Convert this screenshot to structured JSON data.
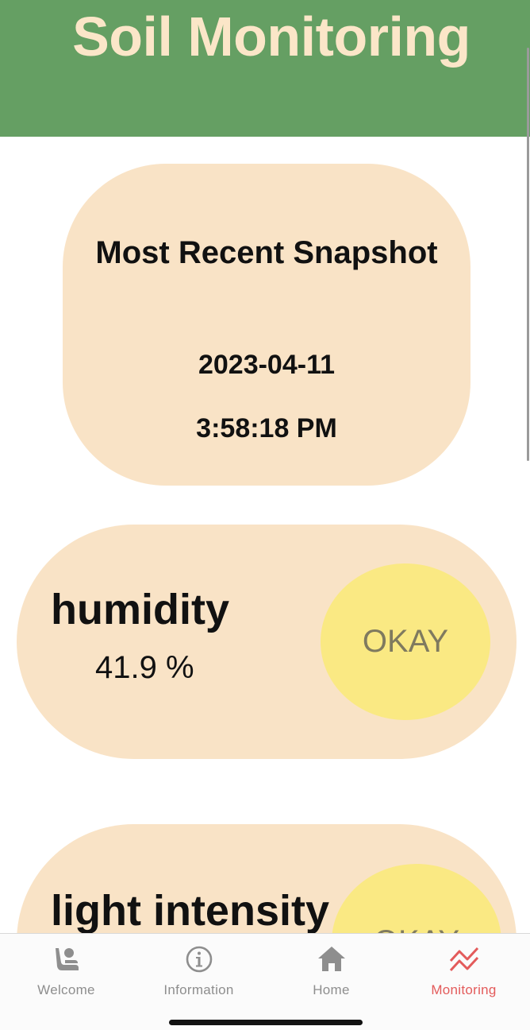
{
  "header": {
    "title": "Soil Monitoring"
  },
  "snapshot": {
    "title": "Most Recent Snapshot",
    "date": "2023-04-11",
    "time": "3:58:18 PM"
  },
  "sensors": [
    {
      "name": "humidity",
      "value": "41.9 %",
      "status": "OKAY"
    },
    {
      "name": "light intensity",
      "status": "OKAY"
    }
  ],
  "tabs": [
    {
      "label": "Welcome",
      "icon": "person-seat-icon",
      "active": false
    },
    {
      "label": "Information",
      "icon": "info-icon",
      "active": false
    },
    {
      "label": "Home",
      "icon": "home-icon",
      "active": false
    },
    {
      "label": "Monitoring",
      "icon": "trend-chart-icon",
      "active": true
    }
  ],
  "colors": {
    "header_bg": "#659f63",
    "header_text": "#fbe6c8",
    "card_bg": "#f9e3c6",
    "status_okay": "#fae983",
    "active_tab": "#e35b5b",
    "inactive_tab": "#8e8e8e"
  }
}
